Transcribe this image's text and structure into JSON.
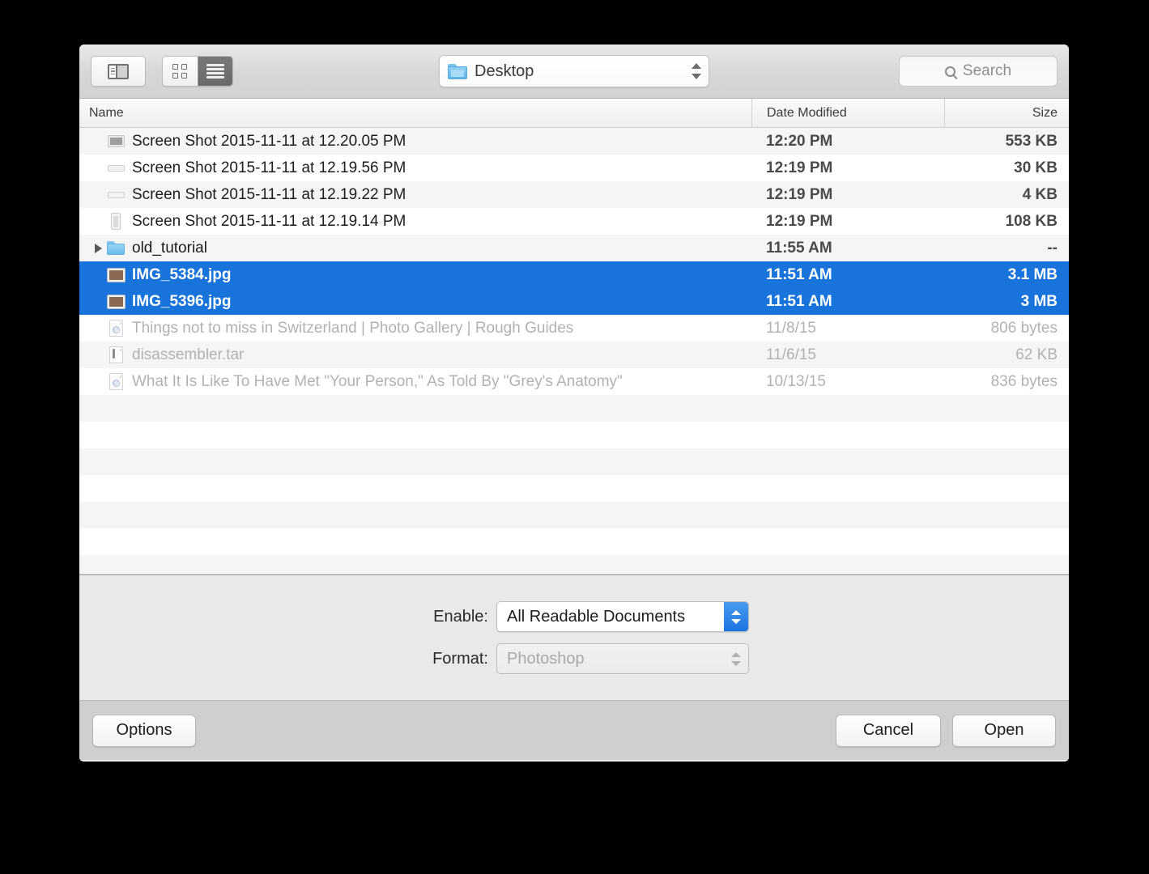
{
  "toolbar": {
    "sidebar_toggle_name": "sidebar-toggle-icon",
    "icon_view_name": "icon-view-icon",
    "list_view_name": "list-view-icon",
    "path_label": "Desktop",
    "path_icon": "folder-icon",
    "search_placeholder": "Search",
    "search_icon": "search-icon"
  },
  "columns": {
    "name": "Name",
    "date_modified": "Date Modified",
    "size": "Size"
  },
  "files": [
    {
      "name": "Screen Shot 2015-11-11 at 12.20.05 PM",
      "date": "12:20 PM",
      "size": "553 KB",
      "icon": "screenshot-thumbnail-icon",
      "icon_style": "wide",
      "state": "normal",
      "expandable": false
    },
    {
      "name": "Screen Shot 2015-11-11 at 12.19.56 PM",
      "date": "12:19 PM",
      "size": "30 KB",
      "icon": "screenshot-thumbnail-icon",
      "icon_style": "bar",
      "state": "normal",
      "expandable": false
    },
    {
      "name": "Screen Shot 2015-11-11 at 12.19.22 PM",
      "date": "12:19 PM",
      "size": "4 KB",
      "icon": "screenshot-thumbnail-icon",
      "icon_style": "bar",
      "state": "normal",
      "expandable": false
    },
    {
      "name": "Screen Shot 2015-11-11 at 12.19.14 PM",
      "date": "12:19 PM",
      "size": "108 KB",
      "icon": "screenshot-thumbnail-icon",
      "icon_style": "tall",
      "state": "normal",
      "expandable": false
    },
    {
      "name": "old_tutorial",
      "date": "11:55 AM",
      "size": "--",
      "icon": "folder-icon",
      "icon_style": "folder",
      "state": "normal",
      "expandable": true
    },
    {
      "name": "IMG_5384.jpg",
      "date": "11:51 AM",
      "size": "3.1 MB",
      "icon": "photo-thumbnail-icon",
      "icon_style": "photo",
      "state": "selected",
      "expandable": false
    },
    {
      "name": "IMG_5396.jpg",
      "date": "11:51 AM",
      "size": "3 MB",
      "icon": "photo-thumbnail-icon",
      "icon_style": "photo",
      "state": "selected",
      "expandable": false
    },
    {
      "name": "Things not to miss in Switzerland | Photo Gallery | Rough Guides",
      "date": "11/8/15",
      "size": "806 bytes",
      "icon": "webloc-document-icon",
      "icon_style": "webloc",
      "state": "disabled",
      "expandable": false
    },
    {
      "name": "disassembler.tar",
      "date": "11/6/15",
      "size": "62 KB",
      "icon": "archive-document-icon",
      "icon_style": "tar",
      "state": "disabled",
      "expandable": false
    },
    {
      "name": "What It Is Like To Have Met \"Your Person,\" As Told By \"Grey's Anatomy\"",
      "date": "10/13/15",
      "size": "836 bytes",
      "icon": "webloc-document-icon",
      "icon_style": "webloc",
      "state": "disabled",
      "expandable": false
    }
  ],
  "accessory": {
    "enable_label": "Enable:",
    "enable_value": "All Readable Documents",
    "format_label": "Format:",
    "format_value": "Photoshop"
  },
  "footer": {
    "options": "Options",
    "cancel": "Cancel",
    "open": "Open"
  },
  "colors": {
    "selection_blue": "#1874db",
    "knob_blue": "#1b74e0",
    "folder_blue": "#76c3ef",
    "window_bg": "#ececec",
    "list_stripe": "#f5f5f5"
  }
}
